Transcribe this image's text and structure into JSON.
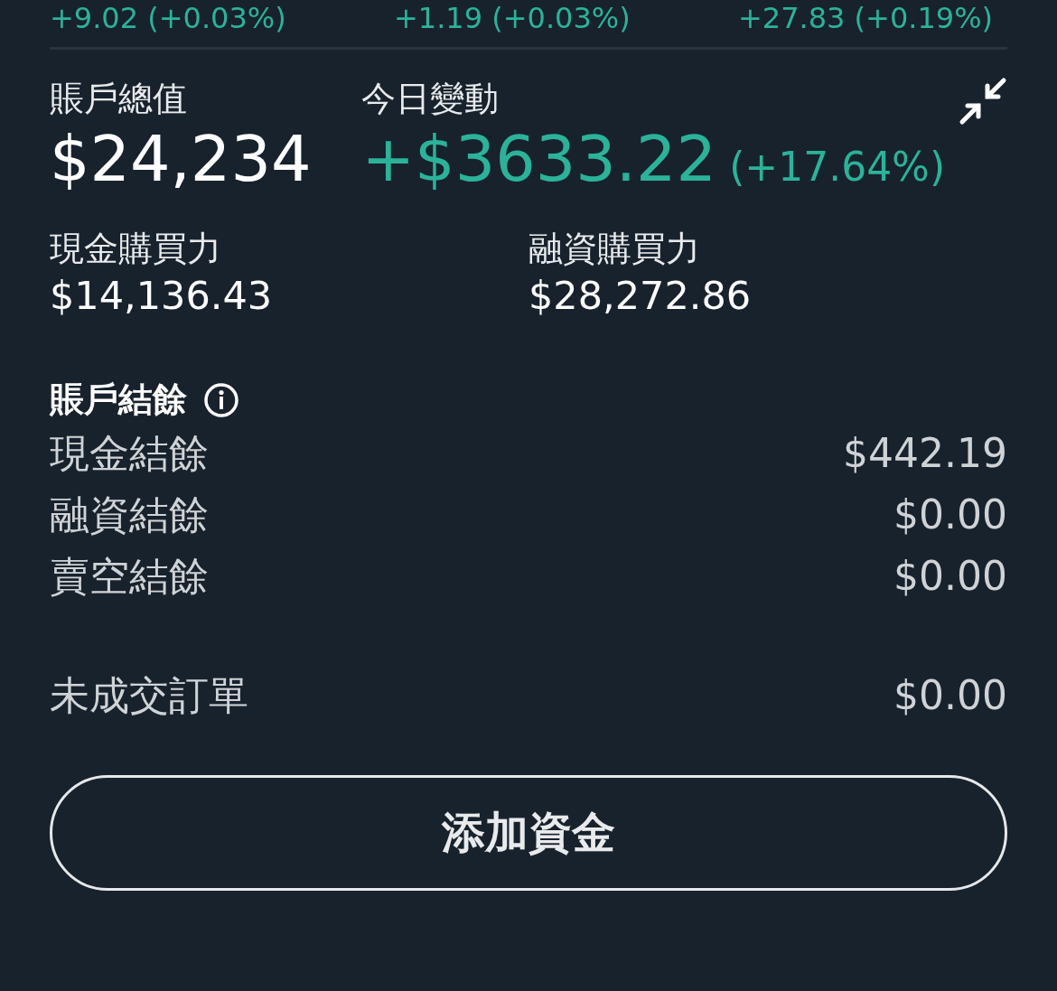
{
  "index_changes": [
    {
      "change": "+9.02 (+0.03%)"
    },
    {
      "change": "+1.19 (+0.03%)"
    },
    {
      "change": "+27.83 (+0.19%)"
    }
  ],
  "account_value": {
    "label": "賬戶總值",
    "value": "$24,234"
  },
  "today_change": {
    "label": "今日變動",
    "value": "+$3633.22",
    "percent": "(+17.64%)"
  },
  "buying_power": [
    {
      "label": "現金購買力",
      "value": "$14,136.43"
    },
    {
      "label": "融資購買力",
      "value": "$28,272.86"
    }
  ],
  "balances": {
    "title": "賬戶結餘",
    "rows": [
      {
        "label": "現金結餘",
        "value": "$442.19"
      },
      {
        "label": "融資結餘",
        "value": "$0.00"
      },
      {
        "label": "賣空結餘",
        "value": "$0.00"
      }
    ]
  },
  "open_orders": {
    "label": "未成交訂單",
    "value": "$0.00"
  },
  "add_funds_button": "添加資金"
}
